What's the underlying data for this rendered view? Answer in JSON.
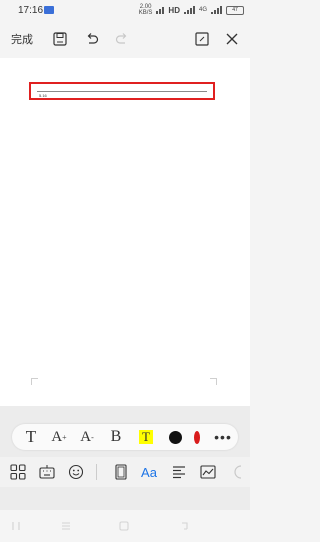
{
  "status_bar": {
    "time": "17:16",
    "speed_value": "2.00",
    "speed_unit": "KB/S",
    "hd": "HD",
    "network": "4G",
    "battery": "47"
  },
  "toolbar": {
    "complete_label": "完成",
    "icons": [
      "save-icon",
      "undo-icon",
      "redo-icon",
      "expand-icon",
      "close-icon"
    ]
  },
  "document": {
    "highlighted_line_text": "5.16"
  },
  "format_bar": {
    "text_label": "T",
    "increase_label": "A",
    "increase_sign": "+",
    "decrease_label": "A",
    "decrease_sign": "-",
    "bold_label": "B",
    "highlight_label": "T",
    "more_label": "•••",
    "colors": {
      "highlight": "#ffff00",
      "text_color": "#111111",
      "red": "#d91c1c"
    }
  },
  "bottom_bar": {
    "font_label": "Aa",
    "accent": "#1c74e6"
  }
}
